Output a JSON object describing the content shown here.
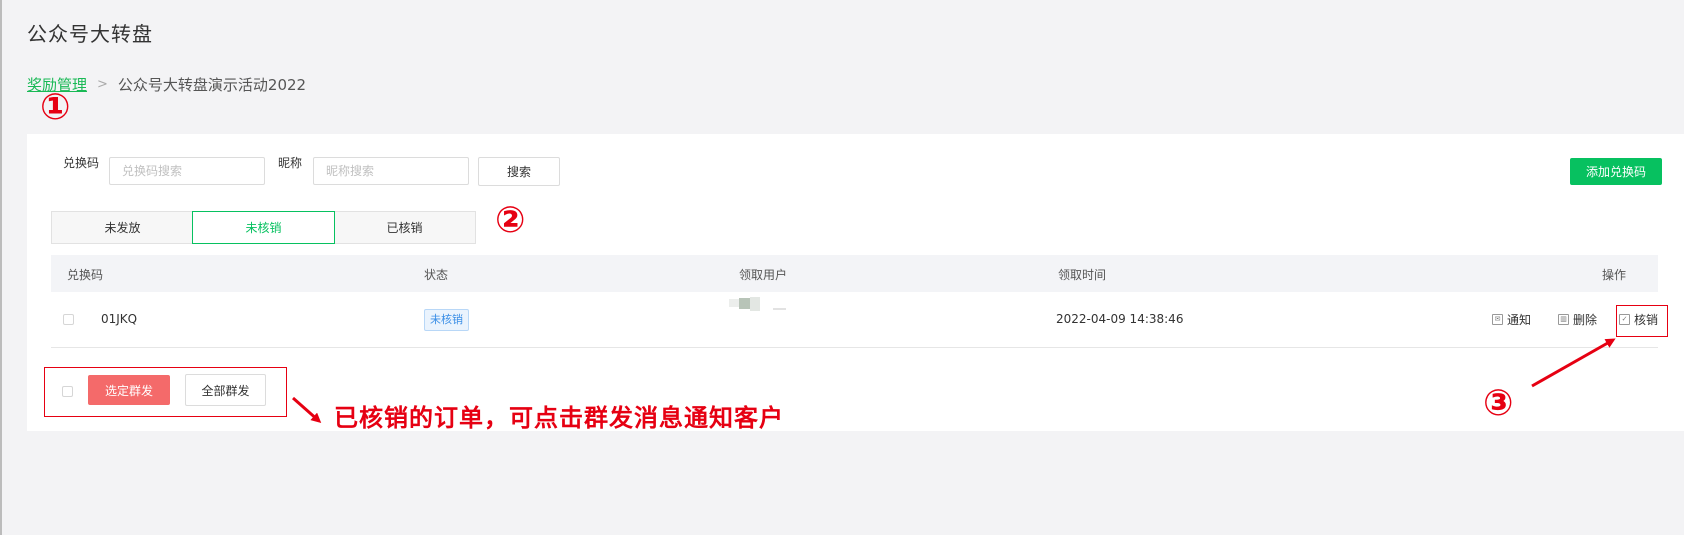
{
  "page": {
    "title": "公众号大转盘"
  },
  "breadcrumb": {
    "parent": "奖励管理",
    "separator": ">",
    "current": "公众号大转盘演示活动2022"
  },
  "filters": {
    "code_label": "兑换码",
    "code_placeholder": "兑换码搜索",
    "nickname_label": "昵称",
    "nickname_placeholder": "昵称搜索",
    "search_button": "搜索",
    "add_button": "添加兑换码"
  },
  "tabs": [
    {
      "label": "未发放",
      "active": false
    },
    {
      "label": "未核销",
      "active": true
    },
    {
      "label": "已核销",
      "active": false
    }
  ],
  "table": {
    "columns": [
      "兑换码",
      "状态",
      "领取用户",
      "领取时间",
      "操作"
    ],
    "rows": [
      {
        "code": "01JKQ",
        "status": "未核销",
        "time": "2022-04-09 14:38:46",
        "actions": {
          "notify": "通知",
          "delete": "删除",
          "verify": "核销"
        }
      }
    ]
  },
  "footer": {
    "send_selected": "选定群发",
    "send_all": "全部群发"
  },
  "annotations": {
    "num1": "①",
    "num2": "②",
    "num3": "③",
    "caption": "已核销的订单，可点击群发消息通知客户",
    "color": "#e60012"
  },
  "colors": {
    "accent": "#07c160",
    "danger": "#f46a6a",
    "annotation": "#e60012"
  }
}
